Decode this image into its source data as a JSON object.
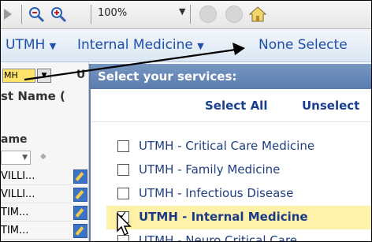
{
  "toolbar": {
    "zoom_value": "100%"
  },
  "header": {
    "item1": "UTMH",
    "item2": "Internal Medicine",
    "item3": "None Selecte"
  },
  "grid": {
    "mini_select": "MH",
    "col_u": "U",
    "col_lastname": "st Name (",
    "col_name": "ame",
    "rows": [
      "VILLI...",
      "VILLI...",
      "TIM...",
      "TIM..."
    ]
  },
  "popup": {
    "title": "Select your services:",
    "select_all": "Select All",
    "unselect": "Unselect",
    "services": [
      "UTMH - Critical Care Medicine",
      "UTMH - Family Medicine",
      "UTMH - Infectious Disease",
      "UTMH - Internal Medicine",
      "UTMH - Neuro Critical Care"
    ],
    "selected_index": 3
  },
  "colors": {
    "accent_blue": "#1f4fa8",
    "popup_header": "#5a7cae",
    "highlight": "#fff2a8"
  }
}
